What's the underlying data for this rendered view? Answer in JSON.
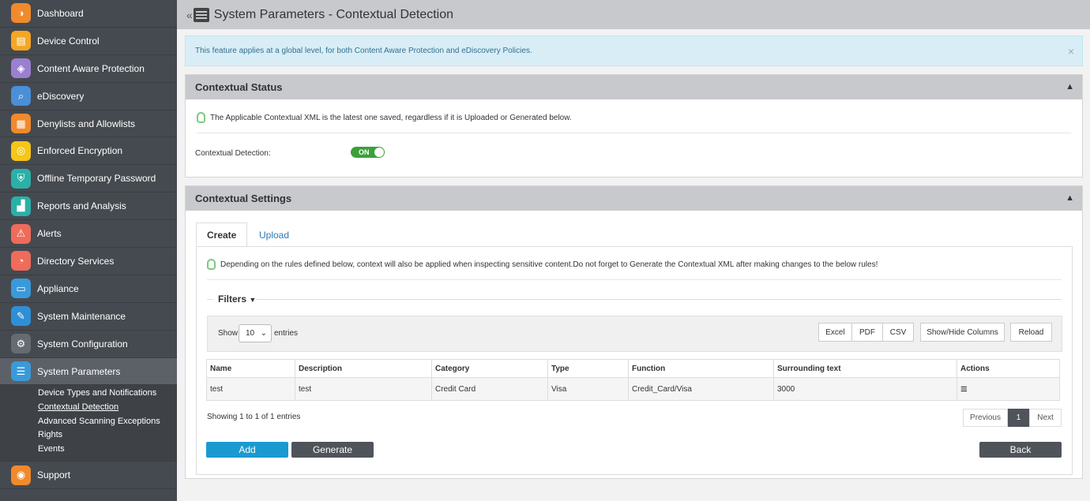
{
  "sidebar": {
    "items": [
      {
        "label": "Dashboard",
        "icon": "dashboard-icon",
        "color": "#f08a2c",
        "glyph": "◑"
      },
      {
        "label": "Device Control",
        "icon": "device-control-icon",
        "color": "#f5a623",
        "glyph": "▤"
      },
      {
        "label": "Content Aware Protection",
        "icon": "content-aware-icon",
        "color": "#9b7fd1",
        "glyph": "◈"
      },
      {
        "label": "eDiscovery",
        "icon": "ediscovery-icon",
        "color": "#4a8fd8",
        "glyph": "⌕"
      },
      {
        "label": "Denylists and Allowlists",
        "icon": "denylists-icon",
        "color": "#f08a2c",
        "glyph": "▦"
      },
      {
        "label": "Enforced Encryption",
        "icon": "encryption-icon",
        "color": "#f5c518",
        "glyph": "◎"
      },
      {
        "label": "Offline Temporary Password",
        "icon": "offline-password-icon",
        "color": "#2ab0a8",
        "glyph": "⛨"
      },
      {
        "label": "Reports and Analysis",
        "icon": "reports-icon",
        "color": "#2ab0a8",
        "glyph": "▟"
      },
      {
        "label": "Alerts",
        "icon": "alerts-icon",
        "color": "#ef6b5a",
        "glyph": "⚠"
      },
      {
        "label": "Directory Services",
        "icon": "directory-icon",
        "color": "#ef6b5a",
        "glyph": "◔"
      },
      {
        "label": "Appliance",
        "icon": "appliance-icon",
        "color": "#3a9ad9",
        "glyph": "▭"
      },
      {
        "label": "System Maintenance",
        "icon": "maintenance-icon",
        "color": "#2e8fd6",
        "glyph": "✎"
      },
      {
        "label": "System Configuration",
        "icon": "configuration-icon",
        "color": "#666b71",
        "glyph": "⚙"
      },
      {
        "label": "System Parameters",
        "icon": "parameters-icon",
        "color": "#3a9ad9",
        "glyph": "☰"
      }
    ],
    "submenu": [
      "Device Types and Notifications",
      "Contextual Detection",
      "Advanced Scanning Exceptions",
      "Rights",
      "Events"
    ],
    "support": {
      "label": "Support",
      "icon": "support-icon",
      "color": "#f08a2c",
      "glyph": "◉"
    }
  },
  "header": {
    "back": "«",
    "title": "System Parameters - Contextual Detection"
  },
  "banner": {
    "text": "This feature applies at a global level, for both Content Aware Protection and eDiscovery Policies.",
    "close": "×"
  },
  "status_panel": {
    "title": "Contextual Status",
    "note": "The Applicable Contextual XML is the latest one saved, regardless if it is Uploaded or Generated below.",
    "label": "Contextual Detection:",
    "toggle": "ON"
  },
  "settings_panel": {
    "title": "Contextual Settings",
    "tabs": [
      "Create",
      "Upload"
    ],
    "note": "Depending on the rules defined below, context will also be applied when inspecting sensitive content.Do not forget to Generate the Contextual XML after making changes to the below rules!",
    "filters": "Filters",
    "show": "Show",
    "entries_value": "10",
    "entries": "entries",
    "export_buttons": [
      "Excel",
      "PDF",
      "CSV"
    ],
    "show_hide": "Show/Hide Columns",
    "reload": "Reload",
    "columns": [
      "Name",
      "Description",
      "Category",
      "Type",
      "Function",
      "Surrounding text",
      "Actions"
    ],
    "rows": [
      [
        "test",
        "test",
        "Credit Card",
        "Visa",
        "Credit_Card/Visa",
        "3000"
      ]
    ],
    "showing": "Showing 1 to 1 of 1 entries",
    "pager": [
      "Previous",
      "1",
      "Next"
    ],
    "add": "Add",
    "generate": "Generate",
    "back": "Back"
  },
  "colors": {
    "accent": "#1b9ad1",
    "dark_button": "#4f545a",
    "toggle_on": "#3aa13a"
  }
}
